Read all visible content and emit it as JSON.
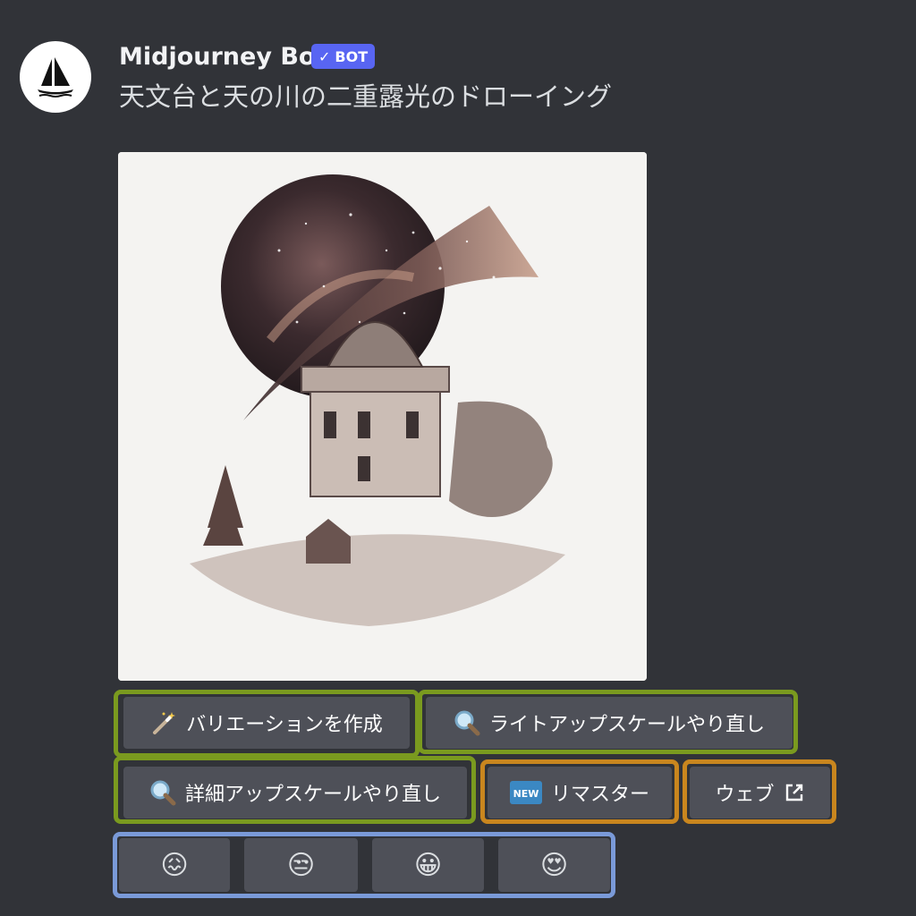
{
  "author": {
    "name": "Midjourney Bot",
    "badge": "BOT",
    "avatar_icon": "sailboat-icon"
  },
  "message": {
    "prompt": "天文台と天の川の二重露光のドローイング"
  },
  "image": {
    "alt": "天文台と天の川の二重露光のドローイング"
  },
  "buttons": {
    "variation": {
      "label": "バリエーションを作成",
      "icon": "magic-wand-icon"
    },
    "redo_light": {
      "label": "ライトアップスケールやり直し",
      "icon": "magnifier-icon"
    },
    "redo_detail": {
      "label": "詳細アップスケールやり直し",
      "icon": "magnifier-icon"
    },
    "remaster": {
      "label": "リマスター",
      "icon": "new-badge-icon"
    },
    "web": {
      "label": "ウェブ",
      "icon": "external-link-icon"
    }
  },
  "reactions": [
    {
      "name": "confounded-face",
      "glyph": "😖"
    },
    {
      "name": "unamused-face",
      "glyph": "😒"
    },
    {
      "name": "grinning-face",
      "glyph": "😀"
    },
    {
      "name": "heart-eyes-face",
      "glyph": "😍"
    }
  ],
  "colors": {
    "background": "#313338",
    "button": "#4e5058",
    "bot_badge": "#5865f2",
    "highlight_green": "#7a9a1f",
    "highlight_orange": "#c9861e",
    "highlight_blue": "#7a9ad8"
  }
}
